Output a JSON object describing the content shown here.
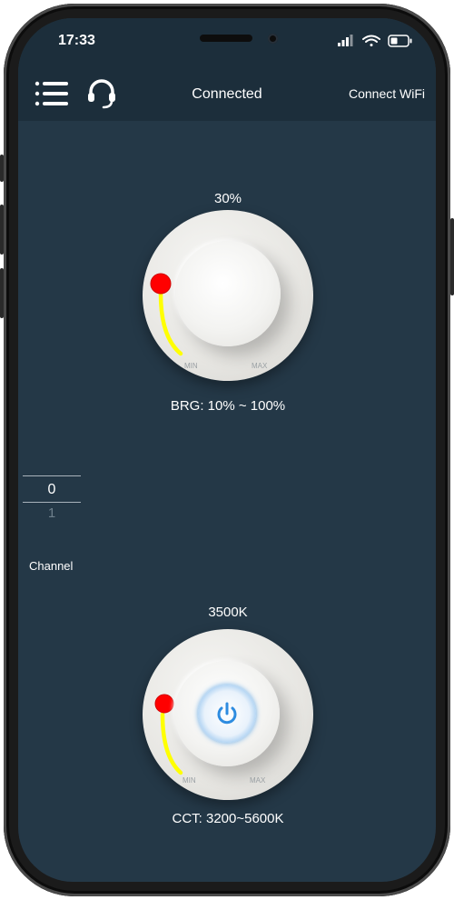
{
  "status_bar": {
    "time": "17:33"
  },
  "app_bar": {
    "connection_status": "Connected",
    "wifi_button_label": "Connect WiFi"
  },
  "brightness": {
    "value_label": "30%",
    "range_label": "BRG: 10% ~ 100%",
    "min_label": "MIN",
    "max_label": "MAX",
    "indicator_color": "#ff0000",
    "arc_color": "#ffff00"
  },
  "channel_picker": {
    "selected": "0",
    "next": "1",
    "label": "Channel"
  },
  "cct": {
    "value_label": "3500K",
    "range_label": "CCT: 3200~5600K",
    "min_label": "MIN",
    "max_label": "MAX",
    "power_icon_color": "#2e8ce0"
  },
  "icons": [
    "menu-list-icon",
    "headset-icon",
    "signal-icon",
    "wifi-icon",
    "battery-icon",
    "power-icon"
  ]
}
